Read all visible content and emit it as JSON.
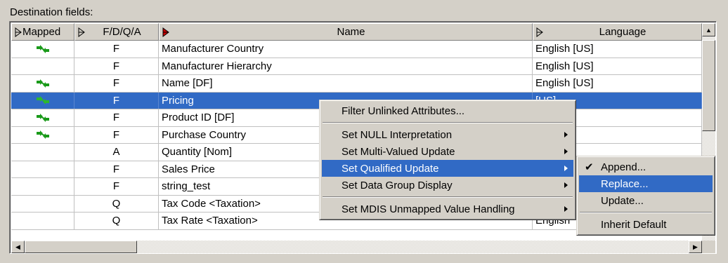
{
  "caption": "Destination fields:",
  "columns": [
    {
      "label": "Mapped"
    },
    {
      "label": "F/D/Q/A"
    },
    {
      "label": "Name"
    },
    {
      "label": "Language"
    }
  ],
  "rows": [
    {
      "mapped": true,
      "fdqa": "F",
      "name": "Manufacturer Country",
      "language": "English [US]",
      "selected": false
    },
    {
      "mapped": false,
      "fdqa": "F",
      "name": "Manufacturer Hierarchy",
      "language": "English [US]",
      "selected": false
    },
    {
      "mapped": true,
      "fdqa": "F",
      "name": "Name [DF]",
      "language": "English [US]",
      "selected": false
    },
    {
      "mapped": true,
      "fdqa": "F",
      "name": "Pricing",
      "language": "[US]",
      "selected": true
    },
    {
      "mapped": true,
      "fdqa": "F",
      "name": "Product ID [DF]",
      "language": "[US]",
      "selected": false
    },
    {
      "mapped": true,
      "fdqa": "F",
      "name": "Purchase Country",
      "language": "[US]",
      "selected": false
    },
    {
      "mapped": false,
      "fdqa": "A",
      "name": "Quantity [Nom]",
      "language": "[US]",
      "selected": false
    },
    {
      "mapped": false,
      "fdqa": "F",
      "name": "Sales Price",
      "language": "",
      "selected": false
    },
    {
      "mapped": false,
      "fdqa": "F",
      "name": "string_test",
      "language": "",
      "selected": false
    },
    {
      "mapped": false,
      "fdqa": "Q",
      "name": "Tax Code <Taxation>",
      "language": "",
      "selected": false
    },
    {
      "mapped": false,
      "fdqa": "Q",
      "name": "Tax Rate <Taxation>",
      "language": "English",
      "selected": false
    }
  ],
  "context_menu": {
    "items": [
      {
        "label": "Filter Unlinked Attributes...",
        "submenu": false
      },
      {
        "separator": true
      },
      {
        "label": "Set NULL Interpretation",
        "submenu": true
      },
      {
        "label": "Set Multi-Valued Update",
        "submenu": true
      },
      {
        "label": "Set Qualified Update",
        "submenu": true,
        "highlighted": true
      },
      {
        "label": "Set Data Group Display",
        "submenu": true
      },
      {
        "separator": true
      },
      {
        "label": "Set MDIS Unmapped Value Handling",
        "submenu": true
      }
    ]
  },
  "submenu": {
    "items": [
      {
        "label": "Append...",
        "checked": true
      },
      {
        "label": "Replace...",
        "highlighted": true
      },
      {
        "label": "Update..."
      },
      {
        "separator": true
      },
      {
        "label": "Inherit Default"
      }
    ]
  },
  "colors": {
    "selection": "#316ac5",
    "mapped_icon": "#1a9a1a",
    "sort_arrow_active": "#cc0000"
  },
  "icons": {
    "mapped": "link-arrows-icon",
    "sort": "sort-triangle-icon",
    "check": "checkmark-icon"
  }
}
